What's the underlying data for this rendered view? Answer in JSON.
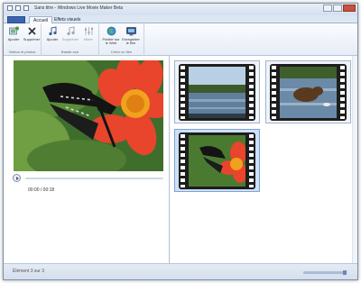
{
  "window": {
    "title": "Sans titre - Windows Live Movie Maker Beta"
  },
  "tabs": [
    {
      "label": "Accueil"
    },
    {
      "label": "Effets visuels"
    }
  ],
  "ribbon": {
    "groups": [
      {
        "label": "Vidéos et photos",
        "buttons": [
          {
            "label": "Ajouter",
            "icon": "add-photos-icon",
            "enabled": true
          },
          {
            "label": "Supprimer",
            "icon": "remove-x-icon",
            "enabled": true
          }
        ]
      },
      {
        "label": "Bande son",
        "buttons": [
          {
            "label": "Ajouter",
            "icon": "add-music-icon",
            "enabled": true
          },
          {
            "label": "Supprimer",
            "icon": "remove-music-icon",
            "enabled": false
          },
          {
            "label": "Mixer",
            "icon": "mix-icon",
            "enabled": false
          }
        ]
      },
      {
        "label": "Créer un film",
        "buttons": [
          {
            "label": "Publier sur le Web",
            "icon": "globe-publish-icon",
            "enabled": true
          },
          {
            "label": "Enregistrer le film",
            "icon": "save-movie-icon",
            "enabled": true
          }
        ]
      }
    ]
  },
  "player": {
    "time": "00:00 / 00:18"
  },
  "storyboard": {
    "clips": [
      {
        "subject": "river-landscape",
        "selected": false
      },
      {
        "subject": "bear-in-river",
        "selected": false
      },
      {
        "subject": "butterfly-on-flower",
        "selected": true
      }
    ]
  },
  "status": {
    "text": "Élément 3 sur 3"
  },
  "colors": {
    "accent": "#3b64b0",
    "selection": "#cde0f7",
    "flower": "#e8452c"
  }
}
